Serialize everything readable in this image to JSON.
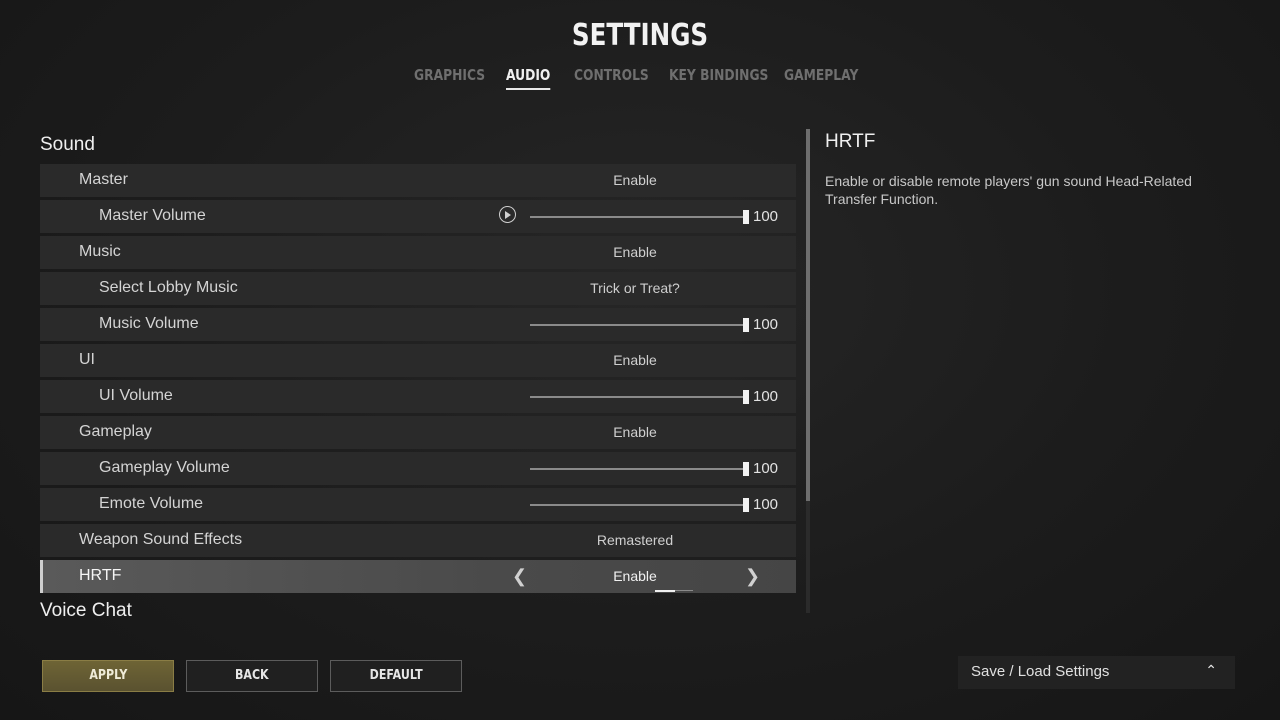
{
  "header": {
    "title": "SETTINGS",
    "tabs": [
      "GRAPHICS",
      "AUDIO",
      "CONTROLS",
      "KEY BINDINGS",
      "GAMEPLAY"
    ],
    "active_tab": "AUDIO"
  },
  "sections": {
    "sound": "Sound",
    "voice_chat": "Voice Chat"
  },
  "rows": [
    {
      "label": "Master",
      "value": "Enable"
    },
    {
      "label": "Master Volume",
      "value": "100",
      "level": 1.0
    },
    {
      "label": "Music",
      "value": "Enable"
    },
    {
      "label": "Select Lobby Music",
      "value": "Trick or Treat?"
    },
    {
      "label": "Music Volume",
      "value": "100",
      "level": 1.0
    },
    {
      "label": "UI",
      "value": "Enable"
    },
    {
      "label": "UI Volume",
      "value": "100",
      "level": 1.0
    },
    {
      "label": "Gameplay",
      "value": "Enable"
    },
    {
      "label": "Gameplay Volume",
      "value": "100",
      "level": 1.0
    },
    {
      "label": "Emote Volume",
      "value": "100",
      "level": 1.0
    },
    {
      "label": "Weapon Sound Effects",
      "value": "Remastered"
    },
    {
      "label": "HRTF",
      "value": "Enable",
      "selected": true
    }
  ],
  "description": {
    "title": "HRTF",
    "text": "Enable or disable remote players' gun sound Head-Related Transfer Function."
  },
  "buttons": {
    "apply": "APPLY",
    "back": "BACK",
    "default": "DEFAULT"
  },
  "save_load": {
    "label": "Save / Load Settings",
    "icon": "chevron-up-icon"
  },
  "icons": {
    "play": "play-icon",
    "prev": "chevron-left-icon",
    "next": "chevron-right-icon"
  }
}
